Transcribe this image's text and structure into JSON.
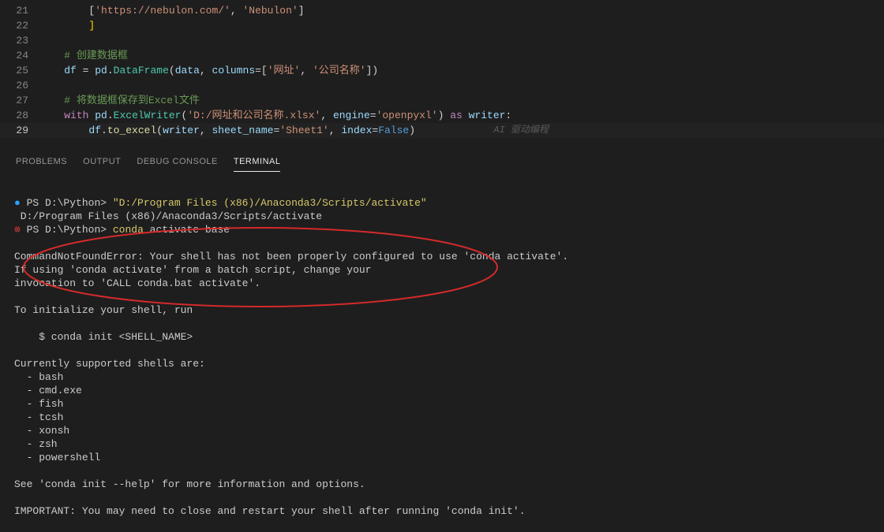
{
  "code": {
    "lines": [
      {
        "n": "21",
        "segs": [
          [
            "        [",
            "punc"
          ],
          [
            "'https://nebulon.com/'",
            "str"
          ],
          [
            ", ",
            "punc"
          ],
          [
            "'Nebulon'",
            "str"
          ],
          [
            "]",
            "punc"
          ]
        ]
      },
      {
        "n": "22",
        "segs": [
          [
            "        ",
            "punc"
          ],
          [
            "]",
            "sbr"
          ]
        ]
      },
      {
        "n": "23",
        "segs": [
          [
            "",
            ""
          ]
        ]
      },
      {
        "n": "24",
        "segs": [
          [
            "    ",
            "punc"
          ],
          [
            "# 创建数据框",
            "comment"
          ]
        ]
      },
      {
        "n": "25",
        "segs": [
          [
            "    ",
            "punc"
          ],
          [
            "df",
            "var"
          ],
          [
            " = ",
            "punc"
          ],
          [
            "pd",
            "var"
          ],
          [
            ".",
            "punc"
          ],
          [
            "DataFrame",
            "cls"
          ],
          [
            "(",
            "punc"
          ],
          [
            "data",
            "var"
          ],
          [
            ", ",
            "punc"
          ],
          [
            "columns",
            "param"
          ],
          [
            "=[",
            "punc"
          ],
          [
            "'网址'",
            "str"
          ],
          [
            ", ",
            "punc"
          ],
          [
            "'公司名称'",
            "str"
          ],
          [
            "])",
            "punc"
          ]
        ]
      },
      {
        "n": "26",
        "segs": [
          [
            "",
            ""
          ]
        ]
      },
      {
        "n": "27",
        "segs": [
          [
            "    ",
            "punc"
          ],
          [
            "# 将数据框保存到Excel文件",
            "comment"
          ]
        ]
      },
      {
        "n": "28",
        "segs": [
          [
            "    ",
            "punc"
          ],
          [
            "with",
            "kw2"
          ],
          [
            " ",
            "punc"
          ],
          [
            "pd",
            "var"
          ],
          [
            ".",
            "punc"
          ],
          [
            "ExcelWriter",
            "cls"
          ],
          [
            "(",
            "punc"
          ],
          [
            "'D:/网址和公司名称.xlsx'",
            "str"
          ],
          [
            ", ",
            "punc"
          ],
          [
            "engine",
            "param"
          ],
          [
            "=",
            "punc"
          ],
          [
            "'openpyxl'",
            "str"
          ],
          [
            ") ",
            "punc"
          ],
          [
            "as",
            "kw2"
          ],
          [
            " ",
            "punc"
          ],
          [
            "writer",
            "var"
          ],
          [
            ":",
            "punc"
          ]
        ]
      },
      {
        "n": "29",
        "active": true,
        "segs": [
          [
            "        ",
            "punc"
          ],
          [
            "df",
            "var"
          ],
          [
            ".",
            "punc"
          ],
          [
            "to_excel",
            "func"
          ],
          [
            "(",
            "punc"
          ],
          [
            "writer",
            "var"
          ],
          [
            ", ",
            "punc"
          ],
          [
            "sheet_name",
            "param"
          ],
          [
            "=",
            "punc"
          ],
          [
            "'Sheet1'",
            "str"
          ],
          [
            ", ",
            "punc"
          ],
          [
            "index",
            "param"
          ],
          [
            "=",
            "punc"
          ],
          [
            "False",
            "const"
          ],
          [
            ")",
            "punc"
          ]
        ]
      }
    ],
    "ai_hint": "AI 驱动编程"
  },
  "panel": {
    "tabs": [
      "PROBLEMS",
      "OUTPUT",
      "DEBUG CONSOLE",
      "TERMINAL"
    ],
    "active_index": 3
  },
  "terminal": {
    "line1_prompt": "PS D:\\Python> ",
    "line1_cmd": "\"D:/Program Files (x86)/Anaconda3/Scripts/activate\"",
    "line2": " D:/Program Files (x86)/Anaconda3/Scripts/activate",
    "line3_prompt": "PS D:\\Python> ",
    "line3_cmd1": "conda",
    "line3_cmd2": " activate base",
    "block": "\nCommandNotFoundError: Your shell has not been properly configured to use 'conda activate'.\nIf using 'conda activate' from a batch script, change your\ninvocation to 'CALL conda.bat activate'.\n\nTo initialize your shell, run\n\n    $ conda init <SHELL_NAME>\n\nCurrently supported shells are:\n  - bash\n  - cmd.exe\n  - fish\n  - tcsh\n  - xonsh\n  - zsh\n  - powershell\n\nSee 'conda init --help' for more information and options.\n\nIMPORTANT: You may need to close and restart your shell after running 'conda init'.\n"
  }
}
